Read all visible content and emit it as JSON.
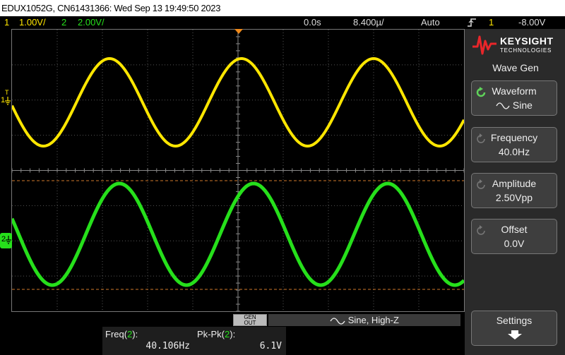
{
  "title_bar": {
    "text": "EDUX1052G, CN61431366: Wed Sep 13 19:49:50 2023"
  },
  "status": {
    "ch1_num": "1",
    "ch1_scale": "1.00V/",
    "ch2_num": "2",
    "ch2_scale": "2.00V/",
    "delay": "0.0s",
    "timebase": "8.400µ/",
    "mode": "Auto",
    "trig_icon": "trigger-edge-icon",
    "trig_ch": "1",
    "trig_level": "-8.00V"
  },
  "grid": {
    "ch1_marker": "1",
    "ch1_trig_marker": "T",
    "ch2_marker": "2",
    "ch1_color": "#ffe600",
    "ch2_color": "#26e01b"
  },
  "logo": {
    "brand": "KEYSIGHT",
    "sub": "TECHNOLOGIES"
  },
  "softkeys": {
    "menu_title": "Wave Gen",
    "waveform_label": "Waveform",
    "waveform_value": "Sine",
    "frequency_label": "Frequency",
    "frequency_value": "40.0Hz",
    "amplitude_label": "Amplitude",
    "amplitude_value": "2.50Vpp",
    "offset_label": "Offset",
    "offset_value": "0.0V",
    "settings_label": "Settings"
  },
  "gen_bar": {
    "out_line1": "GEN",
    "out_line2": "OUT",
    "info": "Sine, High-Z"
  },
  "measurements": [
    {
      "name_prefix": "Freq(",
      "name_ch": "2",
      "name_suffix": "):",
      "value": "40.106Hz"
    },
    {
      "name_prefix": "Pk-Pk(",
      "name_ch": "2",
      "name_suffix": "):",
      "value": "6.1V"
    }
  ]
}
